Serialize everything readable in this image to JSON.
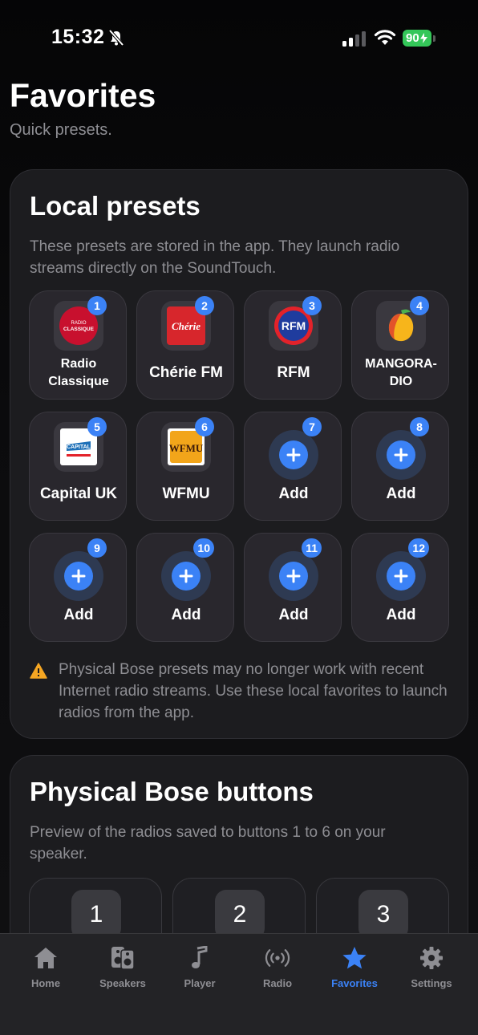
{
  "status_bar": {
    "time": "15:32",
    "battery": "90"
  },
  "header": {
    "title": "Favorites",
    "subtitle": "Quick presets."
  },
  "local_presets": {
    "title": "Local presets",
    "description": "These presets are stored in the app. They launch radio streams directly on the SoundTouch.",
    "tiles": [
      {
        "number": "1",
        "label": "Radio Classique",
        "logo_text": "RADIO CLASSIQUE",
        "logo_bg": "#c8102e"
      },
      {
        "number": "2",
        "label": "Chérie FM",
        "logo_text": "Chérie",
        "logo_bg": "#d7262c"
      },
      {
        "number": "3",
        "label": "RFM",
        "logo_text": "RFM",
        "logo_bg": "#1f3c9e"
      },
      {
        "number": "4",
        "label": "MANGORA-DIO",
        "logo_text": "",
        "logo_bg": "#3a383f"
      },
      {
        "number": "5",
        "label": "Capital UK",
        "logo_text": "CAPITAL",
        "logo_bg": "#ffffff"
      },
      {
        "number": "6",
        "label": "WFMU",
        "logo_text": "WFMU",
        "logo_bg": "#f2a51a"
      },
      {
        "number": "7",
        "label": "Add"
      },
      {
        "number": "8",
        "label": "Add"
      },
      {
        "number": "9",
        "label": "Add"
      },
      {
        "number": "10",
        "label": "Add"
      },
      {
        "number": "11",
        "label": "Add"
      },
      {
        "number": "12",
        "label": "Add"
      }
    ],
    "warning": "Physical Bose presets may no longer work with recent Internet radio streams. Use these local favorites to launch radios from the app."
  },
  "physical_buttons": {
    "title": "Physical Bose buttons",
    "description": "Preview of the radios saved to buttons 1 to 6 on your speaker.",
    "buttons": [
      "1",
      "2",
      "3"
    ]
  },
  "tabbar": {
    "tabs": [
      {
        "label": "Home",
        "icon": "house-icon"
      },
      {
        "label": "Speakers",
        "icon": "speakers-icon"
      },
      {
        "label": "Player",
        "icon": "music-note-icon"
      },
      {
        "label": "Radio",
        "icon": "broadcast-icon"
      },
      {
        "label": "Favorites",
        "icon": "star-icon",
        "active": true
      },
      {
        "label": "Settings",
        "icon": "gear-icon"
      }
    ]
  },
  "colors": {
    "accent": "#3b82f6",
    "warning": "#f5a623",
    "battery": "#34c759"
  }
}
